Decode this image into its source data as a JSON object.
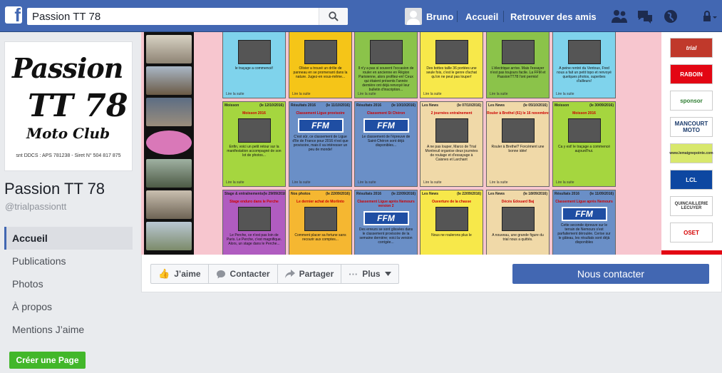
{
  "topbar": {
    "search_value": "Passion TT 78",
    "user_name": "Bruno",
    "home": "Accueil",
    "find_friends": "Retrouver des amis"
  },
  "profile": {
    "logo_lines": [
      "Passion",
      "TT 78",
      "Moto Club",
      "snt DDCS : APS 781238 - Siret N° 504 817 875"
    ],
    "name": "Passion TT 78",
    "handle": "@trialpassiontt"
  },
  "left_nav": [
    "Accueil",
    "Publications",
    "Photos",
    "À propos",
    "Mentions J’aime"
  ],
  "create_page": "Créer une Page",
  "cover": {
    "tiles": [
      {
        "head": [
          "",
          ""
        ],
        "sub": "",
        "img": "photo",
        "text": "le traçage a commencé!",
        "more": "Lire la suite",
        "color": "#7fd3ec"
      },
      {
        "head": [
          "",
          ""
        ],
        "sub": "",
        "img": "photo",
        "text": "Olivier a trouvé un drôle de panneau en se promenant dans la nature. Jugez-en vous-même...",
        "more": "Lire la suite",
        "color": "#f5c518"
      },
      {
        "head": [
          "",
          ""
        ],
        "sub": "",
        "img": "photo",
        "text": "Il n'y a pas si souvent l'occasion de rouler en ancienne en Région Parisienne, alors profitez-en! Ceux qui étaient présents l'année dernière ont déjà renvoyé leur bulletin d'inscription...",
        "more": "Lire la suite",
        "color": "#8bc34a"
      },
      {
        "head": [
          "",
          ""
        ],
        "sub": "",
        "img": "photo",
        "text": "Des bottes taille 36 portées une seule fois, c'est le genre d'achat qu'on ne peut pas louper!",
        "more": "Lire la suite",
        "color": "#f7e84a"
      },
      {
        "head": [
          "",
          ""
        ],
        "sub": "",
        "img": "photo",
        "text": "L'électrique arrive. Mais l'essayer n'est pas toujours facile. La FFM et PassionTT78 l'ont permis!",
        "more": "Lire la suite",
        "color": "#8bc34a"
      },
      {
        "head": [
          "",
          ""
        ],
        "sub": "",
        "img": "photo",
        "text": "A peine rentré du Ventoux, Fred nous a fait un petit topo et renvoyé quelques photos, superbes d'ailleurs!",
        "more": "Lire la suite",
        "color": "#7fd3ec"
      },
      {
        "head": [
          "Moisson",
          "(le 12/10/2016)"
        ],
        "sub": "Moisson 2016",
        "img": "photo",
        "text": "Enfin, voici un petit retour sur la manifestation accompagné de son lot de photos...",
        "more": "Lire la suite",
        "color": "#a5d63f"
      },
      {
        "head": [
          "Résultats 2016",
          "(le 11/10/2016)"
        ],
        "sub": "Classement Ligue provisoire",
        "img": "FFM",
        "text": "C'est sûr, ce classement de Ligue d'Ile de France pour 2016 n'est que provisoire, mais il va intéresser un peu de monde!",
        "more": "Lire la suite",
        "color": "#6a8fc7"
      },
      {
        "head": [
          "Résultats 2016",
          "(le 10/10/2016)"
        ],
        "sub": "Classement St Chéron",
        "img": "FFM",
        "text": "Le classement de l'épreuve de Saint-Chéron sont déjà disponibles...",
        "more": "Lire la suite",
        "color": "#6a8fc7"
      },
      {
        "head": [
          "Les News",
          "(le 07/10/2016)"
        ],
        "sub": "2 journées entraînement",
        "img": "photo",
        "text": "A ne pas louper, Marco de Trial Montreuil organise deux journées de roulage et d'essayage à Caisnes et Larchant",
        "more": "Lire la suite",
        "color": "#f0d9a8"
      },
      {
        "head": [
          "Les News",
          "(le 05/10/2016)"
        ],
        "sub": "Rouler à Brethel (61) le 16 novembre",
        "img": "photo",
        "text": "Rouler à Brethel? Forcément une bonne idée!",
        "more": "Lire la suite",
        "color": "#f0d9a8"
      },
      {
        "head": [
          "Moisson",
          "(le 30/09/2016)"
        ],
        "sub": "Moisson 2016",
        "img": "photo",
        "text": "Ca y est! le traçage a commencé aujourd'hui.",
        "more": "Lire la suite",
        "color": "#a5d63f"
      },
      {
        "head": [
          "Stage & entraînements",
          "(le 29/09/2016)"
        ],
        "sub": "Stage enduro dans le Perche",
        "img": "photo",
        "text": "Le Perche, ce n'est pas loin de Paris. Le Perche, c'est magnifique. Alors, un stage dans le Perche...",
        "more": "",
        "color": "#b05cc0"
      },
      {
        "head": [
          "Nos photos",
          "(le 22/09/2016)"
        ],
        "sub": "Le dernier achat de Morlinto",
        "img": "photo",
        "text": "Comment placer sa fortune sans recourir aux comptes...",
        "more": "",
        "color": "#f5b731"
      },
      {
        "head": [
          "Résultats 2016",
          "(le 22/09/2016)"
        ],
        "sub": "Classement Ligue après Nemours version 2",
        "img": "FFM",
        "text": "Des erreurs se sont glissées dans le classement provisoire de la semaine dernière; voici la version corrigée...",
        "more": "",
        "color": "#6a8fc7"
      },
      {
        "head": [
          "Les News",
          "(le 22/09/2016)"
        ],
        "sub": "Ouverture de la chasse",
        "img": "photo",
        "text": "Nous ne roulerons plus le",
        "more": "",
        "color": "#f7e84a"
      },
      {
        "head": [
          "Les News",
          "(le 18/09/2016)"
        ],
        "sub": "Décès Edouard Baj",
        "img": "photo",
        "text": "A nouveau, une grande figure du trial nous a quittés.",
        "more": "",
        "color": "#f0d9a8"
      },
      {
        "head": [
          "Résultats 2016",
          "(le 11/09/2016)"
        ],
        "sub": "Classement Ligue après Nemours",
        "img": "FFM",
        "text": "Cette seconde épreuve sur le terrain de Nemours s'est parfaitement déroulée. Cerise sur le gâteau, les résultats sont déjà disponibles",
        "more": "",
        "color": "#6a8fc7"
      }
    ],
    "sponsors": [
      "trial",
      "RABOIN",
      "sponsor",
      "MANCOURT MOTO",
      "www.lemaignepointe.com",
      "LCL",
      "QUINCAILLERIE LECUYER",
      "OSET"
    ]
  },
  "actions": {
    "like": "J’aime",
    "contact": "Contacter",
    "share": "Partager",
    "more": "Plus",
    "cta": "Nous contacter"
  }
}
